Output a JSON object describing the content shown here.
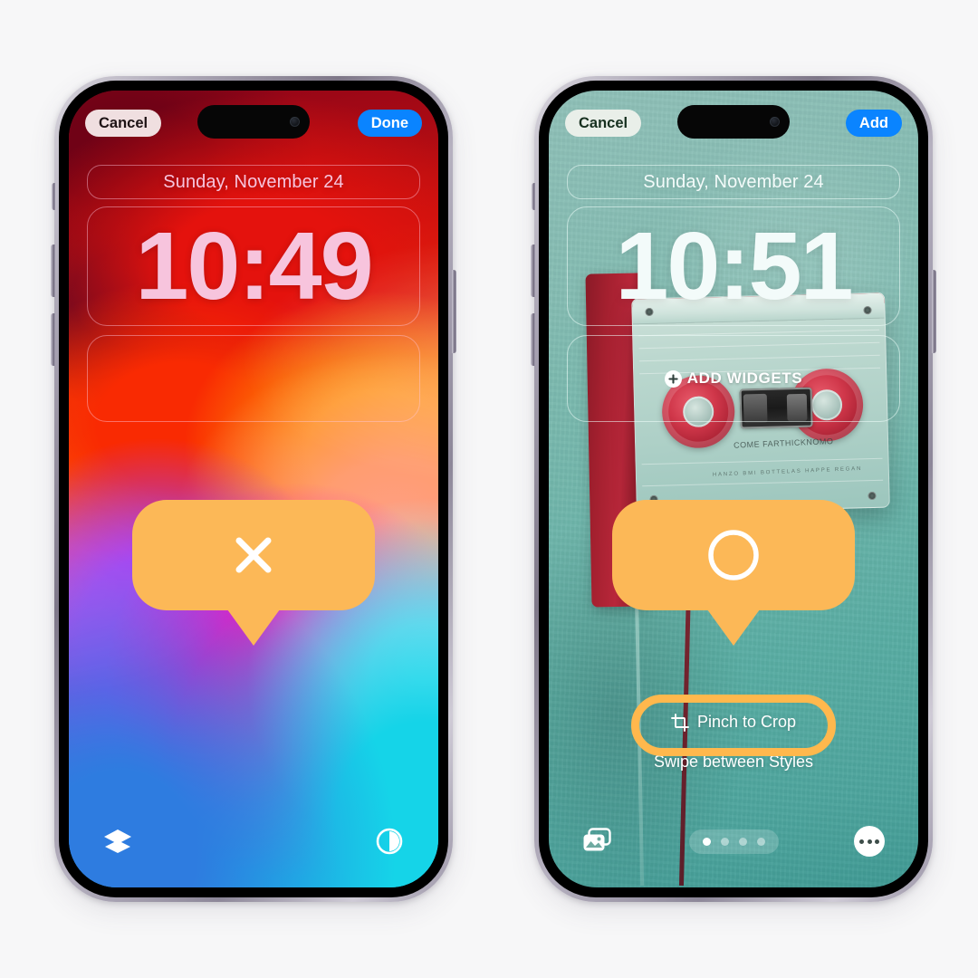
{
  "page": {
    "background_color": "#f7f7f8",
    "accent_orange": "#fcb857",
    "highlight_orange": "#ffb84d",
    "ios_blue": "#0a84ff"
  },
  "phones": [
    {
      "id": "left",
      "topbar": {
        "cancel_label": "Cancel",
        "primary_label": "Done"
      },
      "lockscreen": {
        "date": "Sunday, November 24",
        "time": "10:49",
        "wallpaper": "ios-abstract-gradient"
      },
      "bottom": {
        "left_icon": "layers-icon",
        "right_icon": "depth-contrast-icon"
      },
      "callout": {
        "icon": "close-x-icon"
      }
    },
    {
      "id": "right",
      "topbar": {
        "cancel_label": "Cancel",
        "primary_label": "Add"
      },
      "lockscreen": {
        "date": "Sunday, November 24",
        "time": "10:51",
        "add_widgets_label": "ADD WIDGETS",
        "wallpaper": "cassette-tape-photo"
      },
      "crop": {
        "button_label": "Pinch to Crop",
        "button_icon": "crop-icon",
        "hint_label": "Swipe between Styles",
        "highlighted": true
      },
      "bottom": {
        "left_icon": "photos-stack-icon",
        "right_icon": "more-ellipsis-icon",
        "page_dots_total": 4,
        "page_dots_active_index": 0
      },
      "callout": {
        "icon": "circle-outline-icon"
      }
    }
  ],
  "cassette": {
    "brand_text": "COME FARTHICKNOMO",
    "spec_text": "HANZO   BMI   BOTTELAS   HAPPE   REGAN"
  }
}
